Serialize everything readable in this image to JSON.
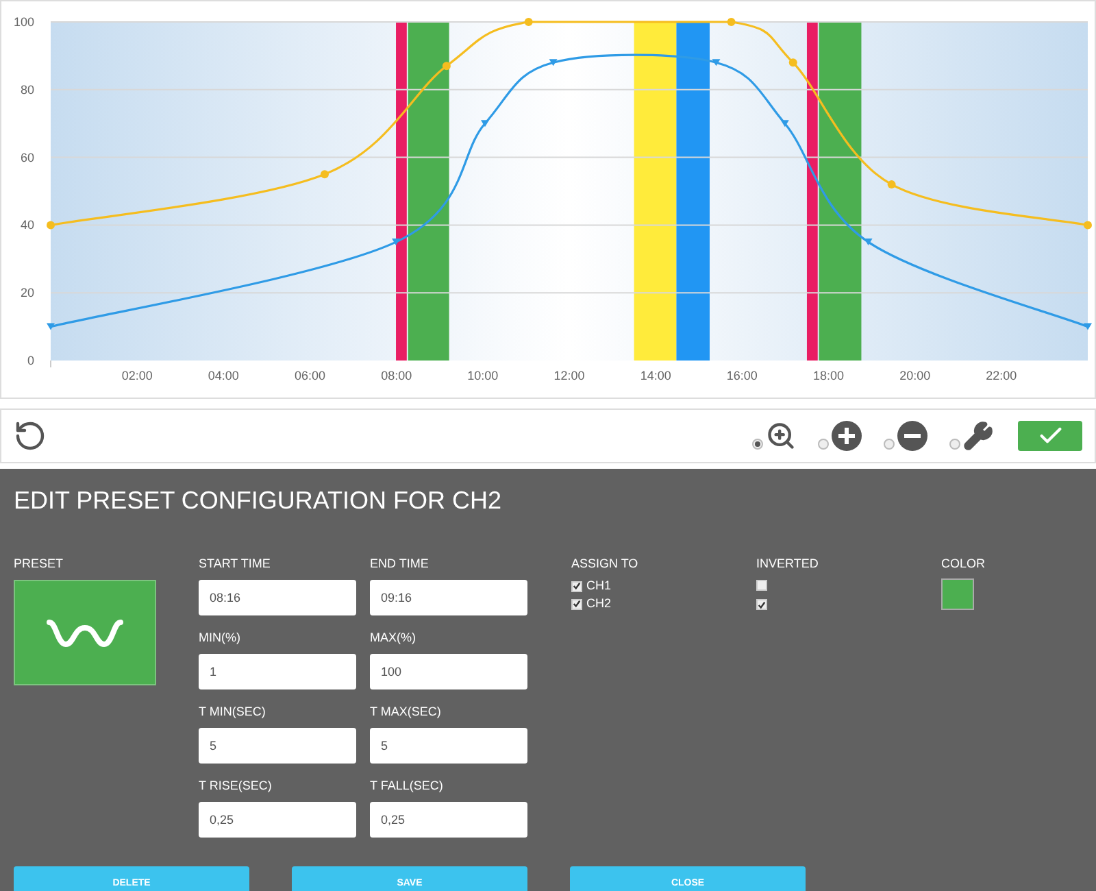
{
  "chart": {
    "chart_data": {
      "type": "line",
      "xlim": [
        0,
        24
      ],
      "ylim": [
        0,
        100
      ],
      "xticks": [
        {
          "value": 2,
          "label": "02:00"
        },
        {
          "value": 4,
          "label": "04:00"
        },
        {
          "value": 6,
          "label": "06:00"
        },
        {
          "value": 8,
          "label": "08:00"
        },
        {
          "value": 10,
          "label": "10:00"
        },
        {
          "value": 12,
          "label": "12:00"
        },
        {
          "value": 14,
          "label": "14:00"
        },
        {
          "value": 16,
          "label": "16:00"
        },
        {
          "value": 18,
          "label": "18:00"
        },
        {
          "value": 20,
          "label": "20:00"
        },
        {
          "value": 22,
          "label": "22:00"
        }
      ],
      "yticks": [
        0,
        20,
        40,
        60,
        80,
        100
      ],
      "series": [
        {
          "color": "#f5bd1f",
          "marker": "circle",
          "x": [
            0,
            6.34,
            9.16,
            11.06,
            15.75,
            17.18,
            19.46,
            24
          ],
          "values": [
            40,
            55,
            87,
            100,
            100,
            88,
            52,
            40
          ]
        },
        {
          "color": "#2f9be6",
          "marker": "triangle",
          "x": [
            0,
            7.99,
            10.05,
            11.63,
            15.4,
            16.99,
            18.92,
            24
          ],
          "values": [
            10,
            35,
            70,
            88,
            88,
            70,
            35,
            10
          ]
        }
      ],
      "grid": true,
      "bands": [
        {
          "axis": "x",
          "from": 7.99,
          "to": 8.24,
          "color": "#e91e63"
        },
        {
          "axis": "x",
          "from": 8.27,
          "to": 9.22,
          "color": "#4caf50"
        },
        {
          "axis": "x",
          "from": 13.5,
          "to": 14.48,
          "color": "#ffeb3b"
        },
        {
          "axis": "x",
          "from": 14.48,
          "to": 15.25,
          "color": "#2196f3"
        },
        {
          "axis": "x",
          "from": 17.5,
          "to": 17.75,
          "color": "#e91e63"
        },
        {
          "axis": "x",
          "from": 17.78,
          "to": 18.76,
          "color": "#4caf50"
        }
      ]
    }
  },
  "toolbar": {
    "tools": [
      {
        "kind": "zoom",
        "selected": true
      },
      {
        "kind": "add",
        "selected": false
      },
      {
        "kind": "remove",
        "selected": false
      },
      {
        "kind": "wrench",
        "selected": false
      }
    ]
  },
  "form": {
    "title": "EDIT PRESET CONFIGURATION FOR CH2",
    "preset": {
      "label": "PRESET"
    },
    "fields": [
      {
        "label": "START TIME",
        "value": "08:16"
      },
      {
        "label": "END TIME",
        "value": "09:16"
      },
      {
        "label": "MIN(%)",
        "value": "1"
      },
      {
        "label": "MAX(%)",
        "value": "100"
      },
      {
        "label": "T MIN(SEC)",
        "value": "5"
      },
      {
        "label": "T MAX(SEC)",
        "value": "5"
      },
      {
        "label": "T RISE(SEC)",
        "value": "0,25"
      },
      {
        "label": "T FALL(SEC)",
        "value": "0,25"
      }
    ],
    "assign": {
      "label": "ASSIGN TO",
      "items": [
        {
          "label": "CH1",
          "checked": true
        },
        {
          "label": "CH2",
          "checked": true
        }
      ]
    },
    "inverted": {
      "label": "INVERTED",
      "items": [
        {
          "checked": false
        },
        {
          "checked": true
        }
      ]
    },
    "color": {
      "label": "COLOR",
      "color": "#4caf50"
    },
    "buttons": [
      "DELETE",
      "SAVE",
      "CLOSE"
    ]
  }
}
